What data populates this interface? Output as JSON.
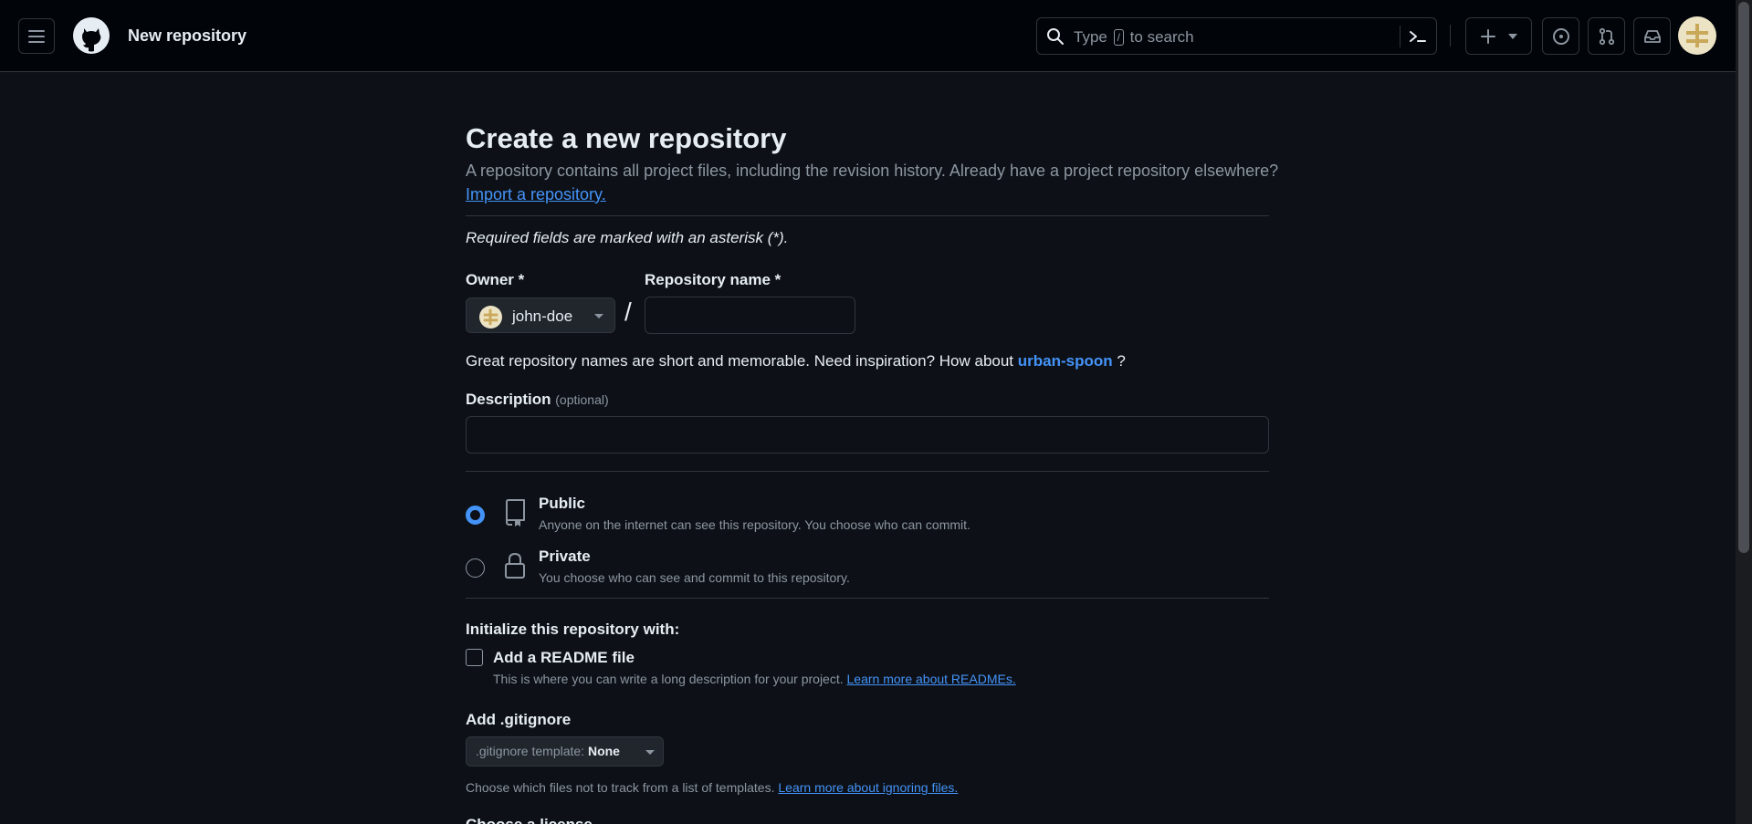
{
  "header": {
    "title": "New repository",
    "search_prefix": "Type",
    "search_key": "/",
    "search_suffix": "to search"
  },
  "main": {
    "title": "Create a new repository",
    "subtitle": "A repository contains all project files, including the revision history. Already have a project repository elsewhere?",
    "import_link": "Import a repository.",
    "required_note": "Required fields are marked with an asterisk (*).",
    "owner_label": "Owner *",
    "owner_value": "john-doe",
    "slash": "/",
    "repo_name_label": "Repository name *",
    "repo_name_value": "",
    "hint_text": "Great repository names are short and memorable. Need inspiration? How about",
    "hint_suggestion": "urban-spoon",
    "hint_end": "?",
    "description_label": "Description",
    "description_optional": "(optional)",
    "description_value": "",
    "visibility": [
      {
        "title": "Public",
        "desc": "Anyone on the internet can see this repository. You choose who can commit.",
        "selected": true
      },
      {
        "title": "Private",
        "desc": "You choose who can see and commit to this repository.",
        "selected": false
      }
    ],
    "init_label": "Initialize this repository with:",
    "readme_title": "Add a README file",
    "readme_checked": false,
    "readme_desc": "This is where you can write a long description for your project.",
    "readme_link": "Learn more about READMEs.",
    "gitignore_label": "Add .gitignore",
    "gitignore_prefix": ".gitignore template:",
    "gitignore_value": "None",
    "gitignore_desc": "Choose which files not to track from a list of templates.",
    "gitignore_link": "Learn more about ignoring files.",
    "license_label_partial": "Choose a license"
  },
  "colors": {
    "background": "#0d1117",
    "header_bg": "#010409",
    "accent": "#4493f8",
    "border": "#30363d",
    "muted_text": "#8d96a0"
  }
}
